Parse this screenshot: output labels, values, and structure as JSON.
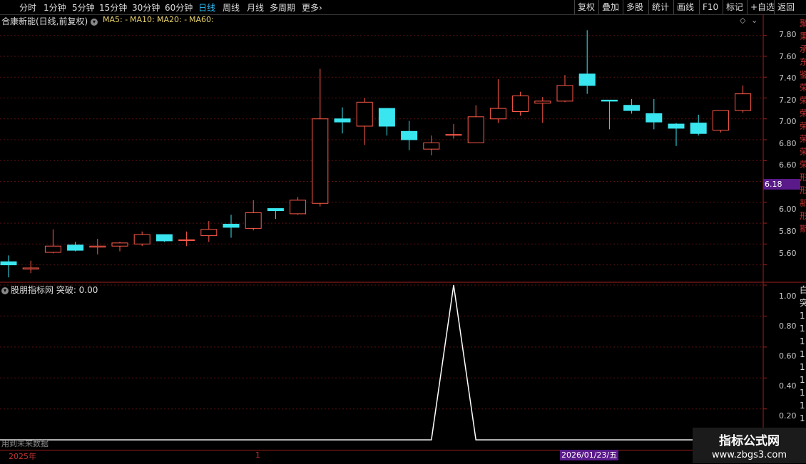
{
  "toolbar": {
    "periods": [
      "分时",
      "1分钟",
      "5分钟",
      "15分钟",
      "30分钟",
      "60分钟",
      "日线",
      "周线",
      "月线",
      "多周期",
      "更多"
    ],
    "active_index": 6,
    "more_arrow": "›",
    "right_buttons": [
      "复权",
      "叠加",
      "多股",
      "统计",
      "画线",
      "F10",
      "标记",
      "+自选",
      "返回"
    ]
  },
  "main": {
    "title": "合康新能(日线,前复权)",
    "ma": [
      "MA5: -",
      "MA10: -",
      "MA20: -",
      "MA60:"
    ],
    "price_tag": "6.18",
    "diamond": "◇",
    "side_text": [
      "聚",
      "秉",
      "承",
      "东",
      "鉴",
      "荣",
      "荣",
      "荣",
      "荣",
      "荣",
      "荣",
      "荣",
      "形",
      "形",
      "新",
      "形",
      "斯"
    ]
  },
  "indicator": {
    "title": "股朋指标网 突破: 0.00",
    "note": "用到未来数据",
    "side_text": [
      "白",
      "突",
      "1",
      "1",
      "1",
      "1",
      "1",
      "1",
      "1",
      "1",
      "1",
      "1"
    ]
  },
  "xaxis": {
    "label_year": "2025年",
    "label_mark": "1",
    "current_date": "2026/01/23/五"
  },
  "logo": {
    "line1": "指标公式网",
    "line2": "www.zbgs3.com"
  },
  "colors": {
    "up": "#ff5a4a",
    "down": "#39e6f0",
    "grid": "#5a1010",
    "line": "#ffffff"
  },
  "chart_data": [
    {
      "type": "candlestick",
      "yaxis_ticks": [
        "7.80",
        "7.60",
        "7.40",
        "7.20",
        "7.00",
        "6.80",
        "6.60",
        "6.40",
        "6.20",
        "6.00",
        "5.80",
        "5.60"
      ],
      "ylim": [
        5.44,
        7.88
      ],
      "candles": [
        {
          "o": 5.63,
          "h": 5.69,
          "l": 5.48,
          "c": 5.6
        },
        {
          "o": 5.56,
          "h": 5.64,
          "l": 5.52,
          "c": 5.57
        },
        {
          "o": 5.72,
          "h": 5.94,
          "l": 5.71,
          "c": 5.78
        },
        {
          "o": 5.79,
          "h": 5.82,
          "l": 5.73,
          "c": 5.74
        },
        {
          "o": 5.77,
          "h": 5.85,
          "l": 5.7,
          "c": 5.78
        },
        {
          "o": 5.78,
          "h": 5.82,
          "l": 5.73,
          "c": 5.81
        },
        {
          "o": 5.8,
          "h": 5.92,
          "l": 5.78,
          "c": 5.89
        },
        {
          "o": 5.89,
          "h": 5.89,
          "l": 5.82,
          "c": 5.83
        },
        {
          "o": 5.84,
          "h": 5.92,
          "l": 5.78,
          "c": 5.84
        },
        {
          "o": 5.88,
          "h": 6.02,
          "l": 5.82,
          "c": 5.94
        },
        {
          "o": 5.99,
          "h": 6.08,
          "l": 5.86,
          "c": 5.96
        },
        {
          "o": 5.95,
          "h": 6.22,
          "l": 5.93,
          "c": 6.1
        },
        {
          "o": 6.14,
          "h": 6.14,
          "l": 6.04,
          "c": 6.12
        },
        {
          "o": 6.09,
          "h": 6.25,
          "l": 6.08,
          "c": 6.22
        },
        {
          "o": 6.19,
          "h": 7.48,
          "l": 6.16,
          "c": 7.0
        },
        {
          "o": 7.0,
          "h": 7.11,
          "l": 6.86,
          "c": 6.97
        },
        {
          "o": 6.93,
          "h": 7.2,
          "l": 6.75,
          "c": 7.16
        },
        {
          "o": 7.1,
          "h": 7.1,
          "l": 6.84,
          "c": 6.93
        },
        {
          "o": 6.88,
          "h": 6.98,
          "l": 6.7,
          "c": 6.8
        },
        {
          "o": 6.71,
          "h": 6.84,
          "l": 6.65,
          "c": 6.77
        },
        {
          "o": 6.85,
          "h": 6.95,
          "l": 6.81,
          "c": 6.85
        },
        {
          "o": 6.77,
          "h": 7.13,
          "l": 6.77,
          "c": 7.02
        },
        {
          "o": 7.0,
          "h": 7.38,
          "l": 6.96,
          "c": 7.1
        },
        {
          "o": 7.07,
          "h": 7.26,
          "l": 7.03,
          "c": 7.22
        },
        {
          "o": 7.15,
          "h": 7.21,
          "l": 6.96,
          "c": 7.17
        },
        {
          "o": 7.17,
          "h": 7.42,
          "l": 7.16,
          "c": 7.32
        },
        {
          "o": 7.43,
          "h": 7.85,
          "l": 7.24,
          "c": 7.32
        },
        {
          "o": 7.18,
          "h": 7.18,
          "l": 6.9,
          "c": 7.17
        },
        {
          "o": 7.13,
          "h": 7.19,
          "l": 7.05,
          "c": 7.08
        },
        {
          "o": 7.05,
          "h": 7.19,
          "l": 6.9,
          "c": 6.97
        },
        {
          "o": 6.95,
          "h": 6.96,
          "l": 6.74,
          "c": 6.91
        },
        {
          "o": 6.96,
          "h": 7.04,
          "l": 6.84,
          "c": 6.86
        },
        {
          "o": 6.89,
          "h": 7.08,
          "l": 6.87,
          "c": 7.08
        },
        {
          "o": 7.08,
          "h": 7.32,
          "l": 7.06,
          "c": 7.24
        }
      ]
    },
    {
      "type": "line",
      "yaxis_ticks": [
        "1.00",
        "0.80",
        "0.60",
        "0.40",
        "0.20"
      ],
      "ylim": [
        -0.05,
        1.0
      ],
      "values": [
        0,
        0,
        0,
        0,
        0,
        0,
        0,
        0,
        0,
        0,
        0,
        0,
        0,
        0,
        0,
        0,
        0,
        0,
        0,
        0,
        1,
        0,
        0,
        0,
        0,
        0,
        0,
        0,
        0,
        0,
        0,
        0,
        0,
        0
      ]
    }
  ]
}
